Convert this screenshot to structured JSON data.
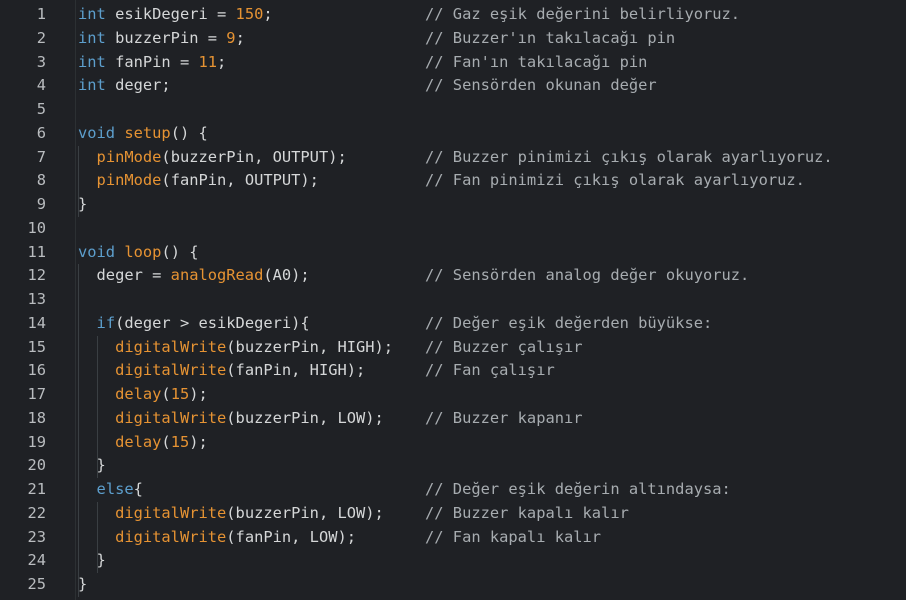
{
  "colors": {
    "background": "#1f2125",
    "keyword": "#5d9fcd",
    "function": "#e69333",
    "number": "#e69333",
    "text": "#d5d7d8",
    "comment": "#a7acb0",
    "line_number": "#b9bcbf"
  },
  "lines": [
    {
      "no": "1",
      "code": [
        {
          "t": "k",
          "v": "int"
        },
        {
          "t": "p",
          "v": " esikDegeri = "
        },
        {
          "t": "n",
          "v": "150"
        },
        {
          "t": "p",
          "v": ";"
        }
      ],
      "comment": "// Gaz eşik değerini belirliyoruz."
    },
    {
      "no": "2",
      "code": [
        {
          "t": "k",
          "v": "int"
        },
        {
          "t": "p",
          "v": " buzzerPin = "
        },
        {
          "t": "n",
          "v": "9"
        },
        {
          "t": "p",
          "v": ";"
        }
      ],
      "comment": "// Buzzer'ın takılacağı pin"
    },
    {
      "no": "3",
      "code": [
        {
          "t": "k",
          "v": "int"
        },
        {
          "t": "p",
          "v": " fanPin = "
        },
        {
          "t": "n",
          "v": "11"
        },
        {
          "t": "p",
          "v": ";"
        }
      ],
      "comment": "// Fan'ın takılacağı pin"
    },
    {
      "no": "4",
      "code": [
        {
          "t": "k",
          "v": "int"
        },
        {
          "t": "p",
          "v": " deger;"
        }
      ],
      "comment": "// Sensörden okunan değer"
    },
    {
      "no": "5",
      "code": [],
      "comment": ""
    },
    {
      "no": "6",
      "code": [
        {
          "t": "k",
          "v": "void"
        },
        {
          "t": "p",
          "v": " "
        },
        {
          "t": "f",
          "v": "setup"
        },
        {
          "t": "p",
          "v": "() {"
        }
      ],
      "comment": ""
    },
    {
      "no": "7",
      "code": [
        {
          "t": "p",
          "v": "  "
        },
        {
          "t": "f",
          "v": "pinMode"
        },
        {
          "t": "p",
          "v": "(buzzerPin, OUTPUT);"
        }
      ],
      "comment": "// Buzzer pinimizi çıkış olarak ayarlıyoruz."
    },
    {
      "no": "8",
      "code": [
        {
          "t": "p",
          "v": "  "
        },
        {
          "t": "f",
          "v": "pinMode"
        },
        {
          "t": "p",
          "v": "(fanPin, OUTPUT);"
        }
      ],
      "comment": "// Fan pinimizi çıkış olarak ayarlıyoruz."
    },
    {
      "no": "9",
      "code": [
        {
          "t": "p",
          "v": "}"
        }
      ],
      "comment": ""
    },
    {
      "no": "10",
      "code": [],
      "comment": ""
    },
    {
      "no": "11",
      "code": [
        {
          "t": "k",
          "v": "void"
        },
        {
          "t": "p",
          "v": " "
        },
        {
          "t": "f",
          "v": "loop"
        },
        {
          "t": "p",
          "v": "() {"
        }
      ],
      "comment": ""
    },
    {
      "no": "12",
      "code": [
        {
          "t": "p",
          "v": "  deger = "
        },
        {
          "t": "f",
          "v": "analogRead"
        },
        {
          "t": "p",
          "v": "(A0);"
        }
      ],
      "comment": "// Sensörden analog değer okuyoruz."
    },
    {
      "no": "13",
      "code": [],
      "comment": ""
    },
    {
      "no": "14",
      "code": [
        {
          "t": "p",
          "v": "  "
        },
        {
          "t": "k",
          "v": "if"
        },
        {
          "t": "p",
          "v": "(deger > esikDegeri){"
        }
      ],
      "comment": "// Değer eşik değerden büyükse:"
    },
    {
      "no": "15",
      "code": [
        {
          "t": "p",
          "v": "    "
        },
        {
          "t": "f",
          "v": "digitalWrite"
        },
        {
          "t": "p",
          "v": "(buzzerPin, HIGH);"
        }
      ],
      "comment": "// Buzzer çalışır"
    },
    {
      "no": "16",
      "code": [
        {
          "t": "p",
          "v": "    "
        },
        {
          "t": "f",
          "v": "digitalWrite"
        },
        {
          "t": "p",
          "v": "(fanPin, HIGH);"
        }
      ],
      "comment": "// Fan çalışır"
    },
    {
      "no": "17",
      "code": [
        {
          "t": "p",
          "v": "    "
        },
        {
          "t": "f",
          "v": "delay"
        },
        {
          "t": "p",
          "v": "("
        },
        {
          "t": "n",
          "v": "15"
        },
        {
          "t": "p",
          "v": ");"
        }
      ],
      "comment": ""
    },
    {
      "no": "18",
      "code": [
        {
          "t": "p",
          "v": "    "
        },
        {
          "t": "f",
          "v": "digitalWrite"
        },
        {
          "t": "p",
          "v": "(buzzerPin, LOW);"
        }
      ],
      "comment": "// Buzzer kapanır"
    },
    {
      "no": "19",
      "code": [
        {
          "t": "p",
          "v": "    "
        },
        {
          "t": "f",
          "v": "delay"
        },
        {
          "t": "p",
          "v": "("
        },
        {
          "t": "n",
          "v": "15"
        },
        {
          "t": "p",
          "v": ");"
        }
      ],
      "comment": ""
    },
    {
      "no": "20",
      "code": [
        {
          "t": "p",
          "v": "  }"
        }
      ],
      "comment": ""
    },
    {
      "no": "21",
      "code": [
        {
          "t": "p",
          "v": "  "
        },
        {
          "t": "k",
          "v": "else"
        },
        {
          "t": "p",
          "v": "{"
        }
      ],
      "comment": "// Değer eşik değerin altındaysa:"
    },
    {
      "no": "22",
      "code": [
        {
          "t": "p",
          "v": "    "
        },
        {
          "t": "f",
          "v": "digitalWrite"
        },
        {
          "t": "p",
          "v": "(buzzerPin, LOW);"
        }
      ],
      "comment": "// Buzzer kapalı kalır"
    },
    {
      "no": "23",
      "code": [
        {
          "t": "p",
          "v": "    "
        },
        {
          "t": "f",
          "v": "digitalWrite"
        },
        {
          "t": "p",
          "v": "(fanPin, LOW);"
        }
      ],
      "comment": "// Fan kapalı kalır"
    },
    {
      "no": "24",
      "code": [
        {
          "t": "p",
          "v": "  }"
        }
      ],
      "comment": ""
    },
    {
      "no": "25",
      "code": [
        {
          "t": "p",
          "v": "}"
        }
      ],
      "comment": ""
    }
  ]
}
